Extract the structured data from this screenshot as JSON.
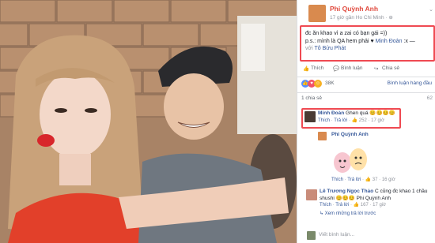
{
  "post": {
    "author": "Phi Quỳnh Anh",
    "meta": "17 giờ gần Ho Chi Minh · ⊕",
    "line1": "đc ăn khao vì a zai có bạn gái =))",
    "line2_prefix": "p.s.: mình là QA hem phải",
    "line2_mention": "Minh Đoàn",
    "line2_suffix": ":x —",
    "line3_prefix": "với",
    "line3_mention": "Tô Bửu Phát",
    "chevron": "⌄"
  },
  "actions": {
    "like": "Thích",
    "comment": "Bình luận",
    "share": "Chia sẻ",
    "top_comments": "Bình luận hàng đầu"
  },
  "reactions": {
    "count": "38K",
    "shares": "1 chia sẻ",
    "comment_count": "62"
  },
  "comments": [
    {
      "author": "Minh Đoàn",
      "text": "Ghen quá 😊😊😊😊",
      "like": "Thích",
      "reply": "Trả lời",
      "likes": "252",
      "time": "17 giờ"
    },
    {
      "author": "Phi Quỳnh Anh",
      "like": "Thích",
      "reply": "Trả lời",
      "likes": "37",
      "time": "16 giờ"
    },
    {
      "author": "Lê Trương Ngọc Thảo",
      "text": "C cũng đc khao 1 chầu",
      "text2": "shushi 😊😊😊 Phi Quỳnh Anh",
      "like": "Thích",
      "reply": "Trả lời",
      "likes": "167",
      "time": "17 giờ"
    }
  ],
  "more_replies": "↳ Xem những trả lời trước",
  "input_placeholder": "Viết bình luận...",
  "icons": {
    "like": "thumbs-up-icon",
    "comment": "speech-bubble-icon",
    "share": "share-arrow-icon",
    "globe": "globe-icon"
  },
  "colors": {
    "accent": "#365899",
    "highlight": "#ef4a52",
    "name_red": "#e0493d"
  }
}
